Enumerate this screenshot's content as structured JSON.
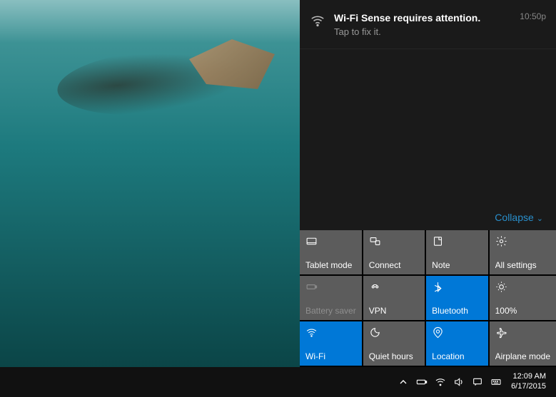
{
  "notification": {
    "title": "Wi-Fi Sense requires attention.",
    "subtitle": "Tap to fix it.",
    "time": "10:50p"
  },
  "collapse_label": "Collapse",
  "tiles": [
    {
      "label": "Tablet mode",
      "icon": "tablet",
      "active": false,
      "disabled": false
    },
    {
      "label": "Connect",
      "icon": "connect",
      "active": false,
      "disabled": false
    },
    {
      "label": "Note",
      "icon": "note",
      "active": false,
      "disabled": false
    },
    {
      "label": "All settings",
      "icon": "settings",
      "active": false,
      "disabled": false
    },
    {
      "label": "Battery saver",
      "icon": "battery",
      "active": false,
      "disabled": true
    },
    {
      "label": "VPN",
      "icon": "vpn",
      "active": false,
      "disabled": false
    },
    {
      "label": "Bluetooth",
      "icon": "bluetooth",
      "active": true,
      "disabled": false
    },
    {
      "label": "100%",
      "icon": "brightness",
      "active": false,
      "disabled": false
    },
    {
      "label": "Wi-Fi",
      "icon": "wifi",
      "active": true,
      "disabled": false
    },
    {
      "label": "Quiet hours",
      "icon": "quiet",
      "active": false,
      "disabled": false
    },
    {
      "label": "Location",
      "icon": "location",
      "active": true,
      "disabled": false
    },
    {
      "label": "Airplane mode",
      "icon": "airplane",
      "active": false,
      "disabled": false
    }
  ],
  "clock": {
    "time": "12:09 AM",
    "date": "6/17/2015"
  }
}
